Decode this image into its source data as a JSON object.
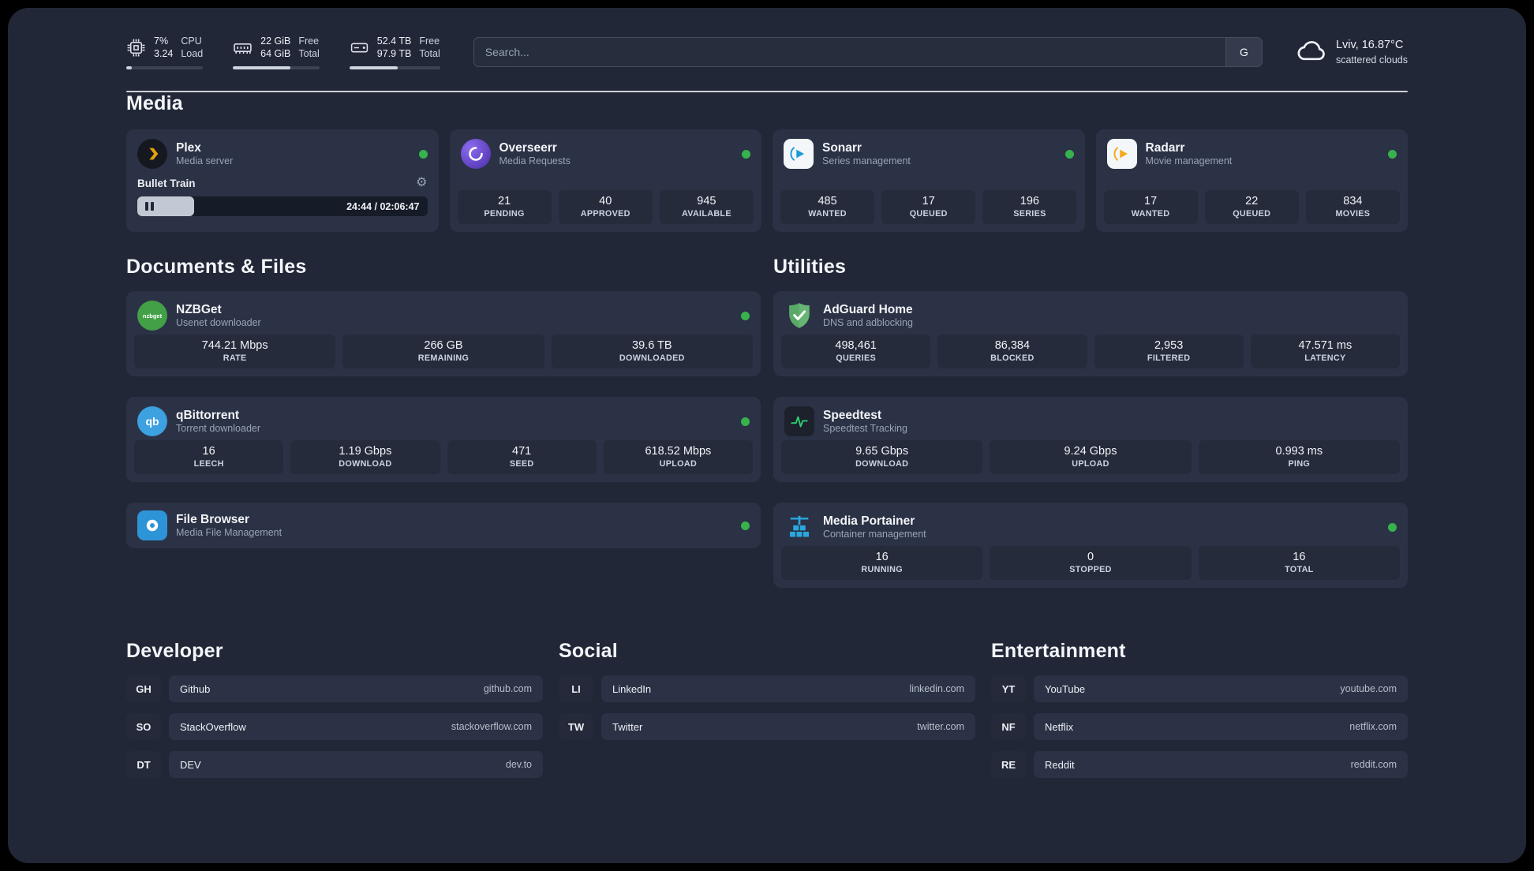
{
  "topbar": {
    "cpu": {
      "value_top": "7%",
      "value_bottom": "3.24",
      "label_top": "CPU",
      "label_bottom": "Load",
      "percent": 7
    },
    "ram": {
      "value_top": "22 GiB",
      "value_bottom": "64 GiB",
      "label_top": "Free",
      "label_bottom": "Total",
      "percent": 66
    },
    "disk": {
      "value_top": "52.4 TB",
      "value_bottom": "97.9 TB",
      "label_top": "Free",
      "label_bottom": "Total",
      "percent": 53
    },
    "search": {
      "placeholder": "Search...",
      "engine_label": "G"
    },
    "weather": {
      "location_temp": "Lviv, 16.87°C",
      "condition": "scattered clouds"
    }
  },
  "icons": {
    "settings_gear": "⚙",
    "nzbget_text": "nzbget",
    "qb_text": "qb"
  },
  "media": {
    "heading": "Media",
    "plex": {
      "title": "Plex",
      "subtitle": "Media server",
      "now_playing": "Bullet Train",
      "time": "24:44 / 02:06:47",
      "progress_percent": 19.5
    },
    "overseerr": {
      "title": "Overseerr",
      "subtitle": "Media Requests",
      "stats": [
        {
          "value": "21",
          "label": "PENDING"
        },
        {
          "value": "40",
          "label": "APPROVED"
        },
        {
          "value": "945",
          "label": "AVAILABLE"
        }
      ]
    },
    "sonarr": {
      "title": "Sonarr",
      "subtitle": "Series management",
      "stats": [
        {
          "value": "485",
          "label": "WANTED"
        },
        {
          "value": "17",
          "label": "QUEUED"
        },
        {
          "value": "196",
          "label": "SERIES"
        }
      ]
    },
    "radarr": {
      "title": "Radarr",
      "subtitle": "Movie management",
      "stats": [
        {
          "value": "17",
          "label": "WANTED"
        },
        {
          "value": "22",
          "label": "QUEUED"
        },
        {
          "value": "834",
          "label": "MOVIES"
        }
      ]
    }
  },
  "documents": {
    "heading": "Documents & Files",
    "nzbget": {
      "title": "NZBGet",
      "subtitle": "Usenet downloader",
      "stats": [
        {
          "value": "744.21 Mbps",
          "label": "RATE"
        },
        {
          "value": "266 GB",
          "label": "REMAINING"
        },
        {
          "value": "39.6 TB",
          "label": "DOWNLOADED"
        }
      ]
    },
    "qbittorrent": {
      "title": "qBittorrent",
      "subtitle": "Torrent downloader",
      "stats": [
        {
          "value": "16",
          "label": "LEECH"
        },
        {
          "value": "1.19 Gbps",
          "label": "DOWNLOAD"
        },
        {
          "value": "471",
          "label": "SEED"
        },
        {
          "value": "618.52 Mbps",
          "label": "UPLOAD"
        }
      ]
    },
    "filebrowser": {
      "title": "File Browser",
      "subtitle": "Media File Management"
    }
  },
  "utilities": {
    "heading": "Utilities",
    "adguard": {
      "title": "AdGuard Home",
      "subtitle": "DNS and adblocking",
      "stats": [
        {
          "value": "498,461",
          "label": "QUERIES"
        },
        {
          "value": "86,384",
          "label": "BLOCKED"
        },
        {
          "value": "2,953",
          "label": "FILTERED"
        },
        {
          "value": "47.571 ms",
          "label": "LATENCY"
        }
      ]
    },
    "speedtest": {
      "title": "Speedtest",
      "subtitle": "Speedtest Tracking",
      "stats": [
        {
          "value": "9.65 Gbps",
          "label": "DOWNLOAD"
        },
        {
          "value": "9.24 Gbps",
          "label": "UPLOAD"
        },
        {
          "value": "0.993 ms",
          "label": "PING"
        }
      ]
    },
    "portainer": {
      "title": "Media Portainer",
      "subtitle": "Container management",
      "stats": [
        {
          "value": "16",
          "label": "RUNNING"
        },
        {
          "value": "0",
          "label": "STOPPED"
        },
        {
          "value": "16",
          "label": "TOTAL"
        }
      ]
    }
  },
  "bookmarks": {
    "developer": {
      "heading": "Developer",
      "items": [
        {
          "abbr": "GH",
          "name": "Github",
          "url": "github.com"
        },
        {
          "abbr": "SO",
          "name": "StackOverflow",
          "url": "stackoverflow.com"
        },
        {
          "abbr": "DT",
          "name": "DEV",
          "url": "dev.to"
        }
      ]
    },
    "social": {
      "heading": "Social",
      "items": [
        {
          "abbr": "LI",
          "name": "LinkedIn",
          "url": "linkedin.com"
        },
        {
          "abbr": "TW",
          "name": "Twitter",
          "url": "twitter.com"
        }
      ]
    },
    "entertainment": {
      "heading": "Entertainment",
      "items": [
        {
          "abbr": "YT",
          "name": "YouTube",
          "url": "youtube.com"
        },
        {
          "abbr": "NF",
          "name": "Netflix",
          "url": "netflix.com"
        },
        {
          "abbr": "RE",
          "name": "Reddit",
          "url": "reddit.com"
        }
      ]
    }
  },
  "colors": {
    "status_online": "#37b24d",
    "plex_accent": "#e5a00d",
    "background": "#212737",
    "card": "#2b3245"
  }
}
